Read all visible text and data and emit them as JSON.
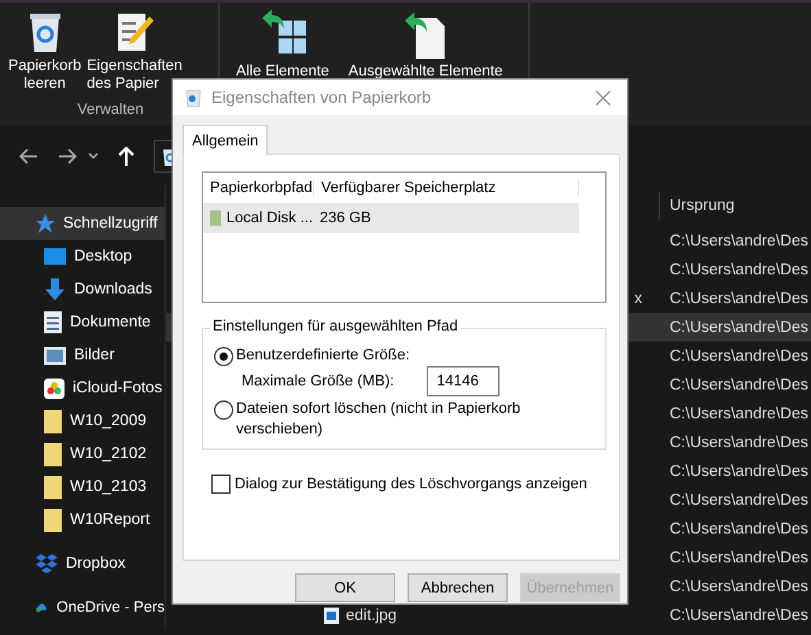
{
  "ribbon": {
    "groups": [
      {
        "label": "Verwalten",
        "buttons": [
          {
            "kind": "bin",
            "lines": [
              "Papierkorb",
              "leeren"
            ]
          },
          {
            "kind": "properties",
            "lines": [
              "Eigenschaften",
              "des Papier"
            ]
          }
        ]
      },
      {
        "buttons": [
          {
            "kind": "restore_all",
            "lines": [
              "Alle Elemente"
            ]
          },
          {
            "kind": "restore_selected",
            "lines": [
              "Ausgewählte Elemente"
            ]
          }
        ]
      }
    ]
  },
  "sidebar": {
    "items": [
      {
        "kind": "star",
        "label": "Schnellzugriff",
        "selected": true
      },
      {
        "kind": "desktop",
        "label": "Desktop",
        "selected": false
      },
      {
        "kind": "download",
        "label": "Downloads",
        "selected": false
      },
      {
        "kind": "document",
        "label": "Dokumente",
        "selected": false
      },
      {
        "kind": "pictures",
        "label": "Bilder",
        "selected": false
      },
      {
        "kind": "photos",
        "label": "iCloud-Fotos",
        "selected": false
      },
      {
        "kind": "folder",
        "label": "W10_2009",
        "selected": false
      },
      {
        "kind": "folder",
        "label": "W10_2102",
        "selected": false
      },
      {
        "kind": "folder",
        "label": "W10_2103",
        "selected": false
      },
      {
        "kind": "folder",
        "label": "W10Report",
        "selected": false
      },
      {
        "kind": "dropbox",
        "label": "Dropbox",
        "selected": false
      },
      {
        "kind": "onedrive",
        "label": "OneDrive - Pers",
        "selected": false
      }
    ]
  },
  "file_list": {
    "columns": [
      "Ursprung"
    ],
    "rows": [
      {
        "name": "",
        "origin": "C:\\Users\\andre\\Des",
        "selected": false
      },
      {
        "name": "",
        "origin": "C:\\Users\\andre\\Des",
        "selected": false
      },
      {
        "name": "x",
        "tail_only": true,
        "origin": "C:\\Users\\andre\\Des",
        "selected": false
      },
      {
        "name": "",
        "origin": "C:\\Users\\andre\\Des",
        "selected": true
      },
      {
        "name": "",
        "origin": "C:\\Users\\andre\\Des",
        "selected": false
      },
      {
        "name": "",
        "origin": "C:\\Users\\andre\\Des",
        "selected": false
      },
      {
        "name": "",
        "origin": "C:\\Users\\andre\\Des",
        "selected": false
      },
      {
        "name": "",
        "origin": "C:\\Users\\andre\\Des",
        "selected": false
      },
      {
        "name": "",
        "origin": "C:\\Users\\andre\\Des",
        "selected": false
      },
      {
        "name": "",
        "origin": "C:\\Users\\andre\\Des",
        "selected": false
      },
      {
        "name": "",
        "origin": "C:\\Users\\andre\\Des",
        "selected": false
      },
      {
        "name": "",
        "origin": "C:\\Users\\andre\\Des",
        "selected": false
      },
      {
        "name": "",
        "origin": "C:\\Users\\andre\\Des",
        "selected": false
      },
      {
        "name": "edit.jpg",
        "origin": "C:\\Users\\andre\\Des",
        "selected": false
      }
    ]
  },
  "dialog": {
    "title": "Eigenschaften von Papierkorb",
    "tabs": [
      {
        "label": "Allgemein",
        "selected": true
      }
    ],
    "locations": {
      "columns": [
        "Papierkorbpfad",
        "Verfügbarer Speicherplatz"
      ],
      "rows": [
        {
          "path": "Local Disk ...",
          "free": "236 GB",
          "selected": true
        }
      ]
    },
    "group_title": "Einstellungen für ausgewählten Pfad",
    "options": [
      {
        "label": "Benutzerdefinierte Größe:",
        "selected": true,
        "size_label": "Maximale Größe (MB):",
        "size_value": "14146"
      },
      {
        "label": "Dateien sofort löschen (nicht in Papierkorb verschieben)",
        "selected": false
      }
    ],
    "confirm": {
      "label": "Dialog zur Bestätigung des Löschvorgangs anzeigen",
      "checked": false
    },
    "buttons": [
      {
        "label": "OK",
        "disabled": false
      },
      {
        "label": "Abbrechen",
        "disabled": false
      },
      {
        "label": "Übernehmen",
        "disabled": true
      }
    ]
  }
}
